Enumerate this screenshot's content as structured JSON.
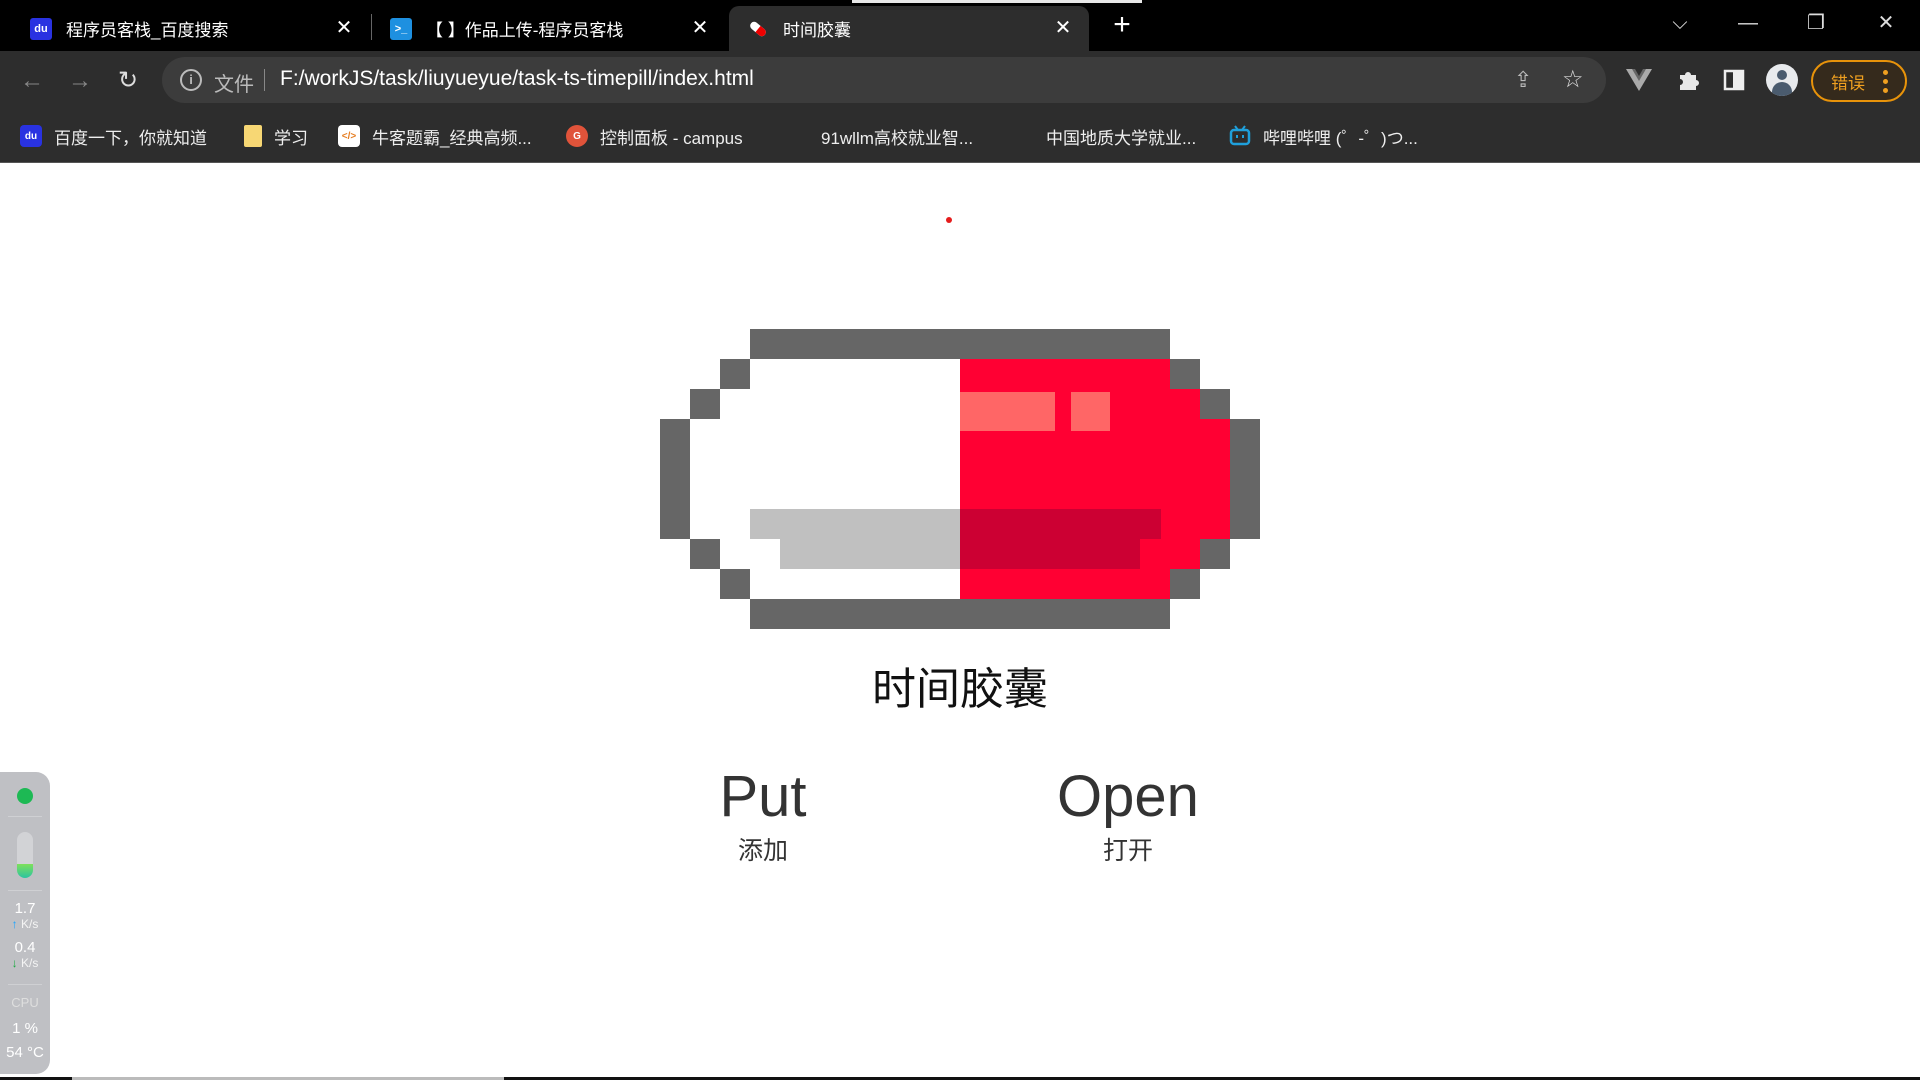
{
  "browser": {
    "tabs": [
      {
        "title": "程序员客栈_百度搜索",
        "icon": "baidu-paw-icon",
        "active": false
      },
      {
        "title": "【        】作品上传-程序员客栈",
        "icon": "terminal-icon",
        "active": false
      },
      {
        "title": "时间胶囊",
        "icon": "pill-icon",
        "active": true
      }
    ],
    "new_tab_label": "+",
    "window_controls": {
      "tab_search": "⌵",
      "minimize": "—",
      "restore": "❐",
      "close": "✕"
    },
    "toolbar": {
      "back": "←",
      "forward": "→",
      "reload": "↻",
      "url_scheme_label": "文件",
      "url": "F:/workJS/task/liuyueyue/task-ts-timepill/index.html",
      "error_button_label": "错误"
    },
    "bookmarks": [
      {
        "label": "百度一下，你就知道",
        "icon": "baidu-paw-icon"
      },
      {
        "label": "学习",
        "icon": "folder-icon"
      },
      {
        "label": "牛客题霸_经典高频...",
        "icon": "nowcoder-icon"
      },
      {
        "label": "控制面板 - campus",
        "icon": "campus-icon"
      },
      {
        "label": "91wllm高校就业智...",
        "icon": ""
      },
      {
        "label": "中国地质大学就业...",
        "icon": ""
      },
      {
        "label": "哔哩哔哩 (゜-゜)つ...",
        "icon": "bilibili-icon"
      }
    ]
  },
  "page": {
    "title": "时间胶囊",
    "actions": [
      {
        "label": "Put",
        "sublabel": "添加"
      },
      {
        "label": "Open",
        "sublabel": "打开"
      }
    ],
    "colors": {
      "pill_outline": "#666666",
      "pill_red": "#ff0033",
      "pill_highlight": "#ff6666",
      "pill_shadow_red": "#cc0033",
      "pill_shadow_gray": "#c0c0c0",
      "pill_white": "#ffffff"
    }
  },
  "system_widget": {
    "status": "online",
    "memory_fill": 0.3,
    "upload_speed": "1.7",
    "upload_unit": "K/s",
    "download_speed": "0.4",
    "download_unit": "K/s",
    "cpu_label": "CPU",
    "cpu_usage": "1 %",
    "cpu_temp": "54 °C"
  }
}
